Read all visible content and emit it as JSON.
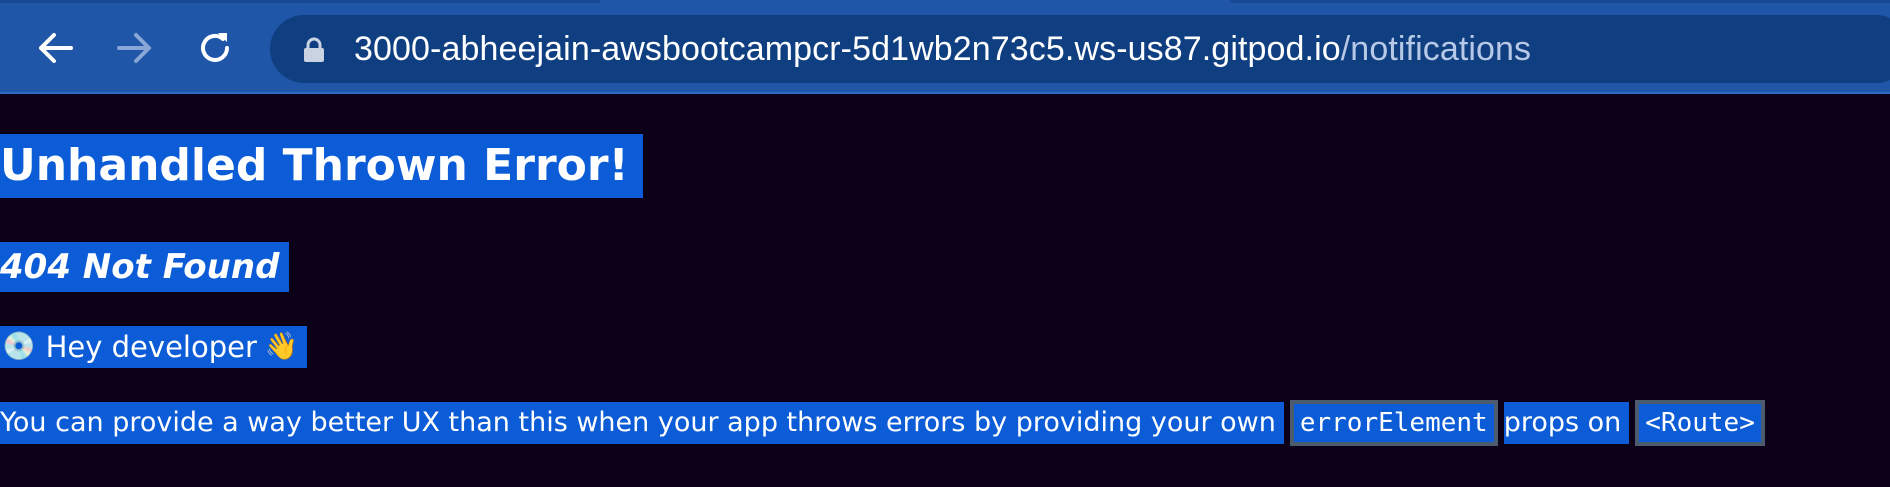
{
  "browser": {
    "url_host": "3000-abheejain-awsbootcampcr-5d1wb2n73c5.ws-us87.gitpod.io",
    "url_path": "/notifications",
    "nav": {
      "back": "back-arrow-icon",
      "forward": "forward-arrow-icon",
      "reload": "reload-icon",
      "lock": "lock-icon"
    }
  },
  "page": {
    "heading": "Unhandled Thrown Error!",
    "status": "404 Not Found",
    "hey": {
      "icon_left": "💿",
      "text": "Hey developer",
      "icon_right": "👋"
    },
    "message": {
      "before": "You can provide a way better UX than this when your app throws errors by providing your own",
      "code1": "errorElement",
      "middle": "props on",
      "code2": "<Route>"
    }
  },
  "colors": {
    "chrome": "#1f56a8",
    "omnibox": "#0f3f80",
    "page_bg": "#0c0018",
    "selection": "#0b5cd6"
  }
}
